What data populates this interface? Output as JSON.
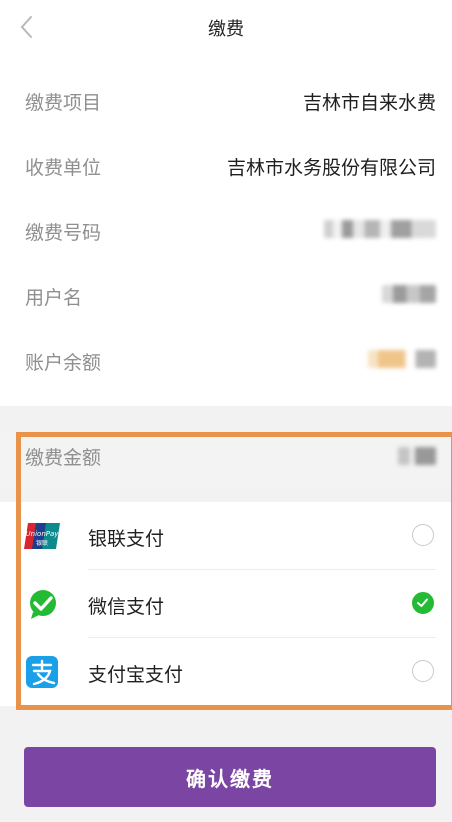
{
  "header": {
    "title": "缴费"
  },
  "info": {
    "project_label": "缴费项目",
    "project_value": "吉林市自来水费",
    "unit_label": "收费单位",
    "unit_value": "吉林市水务股份有限公司",
    "number_label": "缴费号码",
    "username_label": "用户名",
    "balance_label": "账户余额"
  },
  "amount": {
    "label": "缴费金额"
  },
  "payment": {
    "methods": [
      {
        "name": "银联支付",
        "icon": "unionpay-icon",
        "selected": false
      },
      {
        "name": "微信支付",
        "icon": "wechat-pay-icon",
        "selected": true
      },
      {
        "name": "支付宝支付",
        "icon": "alipay-icon",
        "selected": false
      }
    ]
  },
  "confirm": {
    "label": "确认缴费"
  },
  "colors": {
    "accent": "#7a45a3",
    "selected": "#22bb33",
    "highlight": "#e8924a"
  }
}
